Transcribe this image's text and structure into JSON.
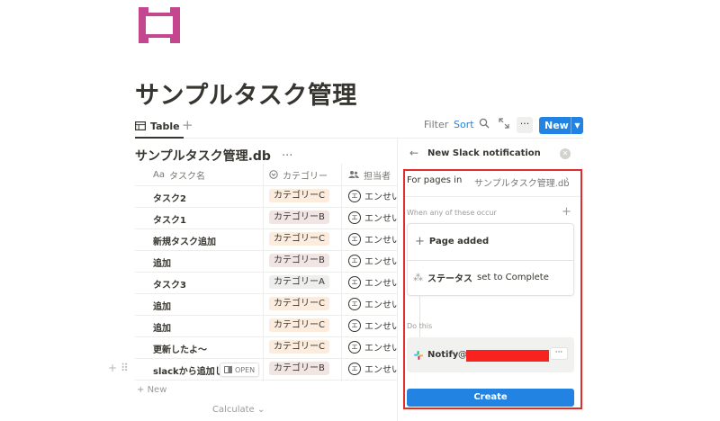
{
  "page": {
    "title": "サンプルタスク管理",
    "icon": "castle-icon",
    "icon_color": "#c4468e"
  },
  "toolbar": {
    "view_tab_label": "Table",
    "filter_label": "Filter",
    "sort_label": "Sort",
    "more_label": "···",
    "new_label": "New",
    "accent": "#2383e2"
  },
  "database": {
    "title": "サンプルタスク管理.db",
    "more_label": "···",
    "columns": [
      {
        "icon": "text-icon",
        "icon_text": "Aa",
        "label": "タスク名"
      },
      {
        "icon": "select-icon",
        "label": "カテゴリー"
      },
      {
        "icon": "people-icon",
        "label": "担当者"
      }
    ],
    "rows": [
      {
        "name": "タスク2",
        "category": "カテゴリーC",
        "cat": "c",
        "assignee": "エンせい"
      },
      {
        "name": "タスク1",
        "category": "カテゴリーB",
        "cat": "b",
        "assignee": "エンせい"
      },
      {
        "name": "新規タスク追加",
        "category": "カテゴリーC",
        "cat": "c",
        "assignee": "エンせい"
      },
      {
        "name": "追加",
        "category": "カテゴリーB",
        "cat": "b",
        "assignee": "エンせい"
      },
      {
        "name": "タスク3",
        "category": "カテゴリーA",
        "cat": "a",
        "assignee": "エンせい"
      },
      {
        "name": "追加",
        "category": "カテゴリーC",
        "cat": "c",
        "assignee": "エンせい"
      },
      {
        "name": "追加",
        "category": "カテゴリーC",
        "cat": "c",
        "assignee": "エンせい"
      },
      {
        "name": "更新したよ〜",
        "category": "カテゴリーC",
        "cat": "c",
        "assignee": "エンせい"
      },
      {
        "name": "slackから追加し",
        "category": "カテゴリーB",
        "cat": "b",
        "assignee": "エンせい"
      }
    ],
    "avatar_glyph": "エ",
    "open_label": "OPEN",
    "new_row_label": "New",
    "calculate_label": "Calculate"
  },
  "panel": {
    "title": "New Slack notification",
    "for_pages_label": "For pages in",
    "for_pages_value": "サンプルタスク管理.db",
    "when_label": "When any of these occur",
    "trigger1": "Page added",
    "trigger2_prop": "ステータス",
    "trigger2_rest": "set to Complete",
    "do_this_label": "Do this",
    "action_label": "Notify",
    "action_at": "@",
    "action_more": "···",
    "create_label": "Create",
    "highlight_color": "#e32b2b"
  }
}
